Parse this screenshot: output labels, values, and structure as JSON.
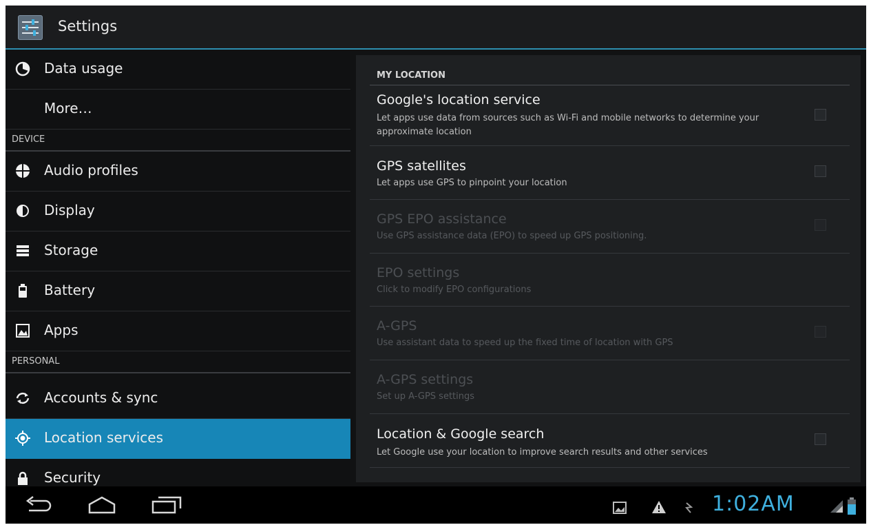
{
  "action_bar": {
    "title": "Settings"
  },
  "left_items": [
    {
      "id": "data-usage",
      "label": "Data usage",
      "icon": "data-usage-icon"
    },
    {
      "id": "more",
      "label": "More…",
      "icon": ""
    },
    {
      "id": "audio-profiles",
      "label": "Audio profiles",
      "icon": "audio-profiles-icon"
    },
    {
      "id": "display",
      "label": "Display",
      "icon": "display-icon"
    },
    {
      "id": "storage",
      "label": "Storage",
      "icon": "storage-icon"
    },
    {
      "id": "battery",
      "label": "Battery",
      "icon": "battery-icon"
    },
    {
      "id": "apps",
      "label": "Apps",
      "icon": "apps-icon"
    },
    {
      "id": "accounts-sync",
      "label": "Accounts & sync",
      "icon": "sync-icon"
    },
    {
      "id": "location-services",
      "label": "Location services",
      "icon": "location-icon",
      "selected": true
    },
    {
      "id": "security",
      "label": "Security",
      "icon": "lock-icon"
    }
  ],
  "sections": {
    "device": "DEVICE",
    "personal": "PERSONAL"
  },
  "right": {
    "category": "MY LOCATION",
    "prefs": [
      {
        "title": "Google's location service",
        "summary": "Let apps use data from sources such as Wi-Fi and mobile networks to determine your approximate location",
        "checkbox": true,
        "checked": false,
        "enabled": true
      },
      {
        "title": "GPS satellites",
        "summary": "Let apps use GPS to pinpoint your location",
        "checkbox": true,
        "checked": false,
        "enabled": true
      },
      {
        "title": "GPS EPO assistance",
        "summary": "Use GPS assistance data (EPO) to speed up GPS positioning.",
        "checkbox": true,
        "checked": false,
        "enabled": false
      },
      {
        "title": "EPO settings",
        "summary": "Click to modify EPO configurations",
        "checkbox": false,
        "enabled": false
      },
      {
        "title": "A-GPS",
        "summary": "Use assistant data to speed up the fixed time of location with GPS",
        "checkbox": true,
        "checked": false,
        "enabled": false
      },
      {
        "title": "A-GPS settings",
        "summary": "Set up A-GPS settings",
        "checkbox": false,
        "enabled": false
      },
      {
        "title": "Location & Google search",
        "summary": "Let Google use your location to improve search results and other services",
        "checkbox": true,
        "checked": false,
        "enabled": true
      }
    ]
  },
  "status_bar": {
    "time": "1:02AM"
  },
  "colors": {
    "accent": "#33b5e5",
    "selected": "#1786b7",
    "clock": "#3fb0de"
  }
}
